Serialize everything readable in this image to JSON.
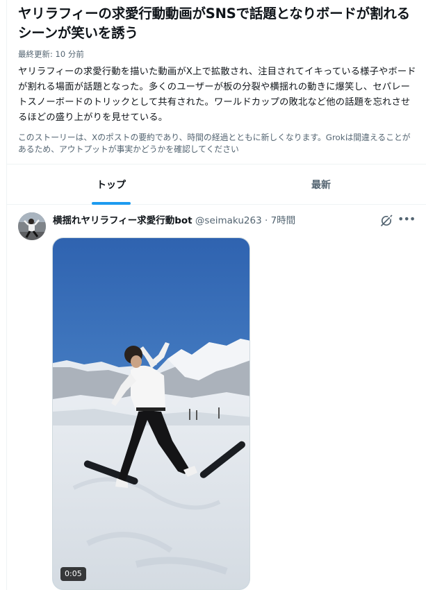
{
  "story": {
    "title": "ヤリラフィーの求愛行動動画がSNSで話題となりボードが割れるシーンが笑いを誘う",
    "updated": "最終更新: 10 分前",
    "summary": "ヤリラフィーの求愛行動を描いた動画がX上で拡散され、注目されてイキっている様子やボードが割れる場面が話題となった。多くのユーザーが板の分裂や横揺れの動きに爆笑し、セパレートスノーボードのトリックとして共有された。ワールドカップの敗北など他の話題を忘れさせるほどの盛り上がりを見せている。",
    "disclaimer": "このストーリーは、Xのポストの要約であり、時間の経過とともに新しくなります。Grokは間違えることがあるため、アウトプットが事実かどうかを確認してください"
  },
  "tabs": [
    {
      "label": "トップ",
      "active": true
    },
    {
      "label": "最新",
      "active": false
    }
  ],
  "post": {
    "display_name": "横揺れヤリラフィー求愛行動bot",
    "handle": "@seimaku263",
    "separator": "·",
    "time": "7時間",
    "video_duration": "0:05",
    "icons": [
      "avatar-image",
      "grok-icon",
      "more-icon",
      "video-thumbnail"
    ]
  },
  "colors": {
    "accent": "#1d9bf0",
    "text": "#0f1419",
    "secondary": "#536471",
    "border": "#eff3f4"
  }
}
